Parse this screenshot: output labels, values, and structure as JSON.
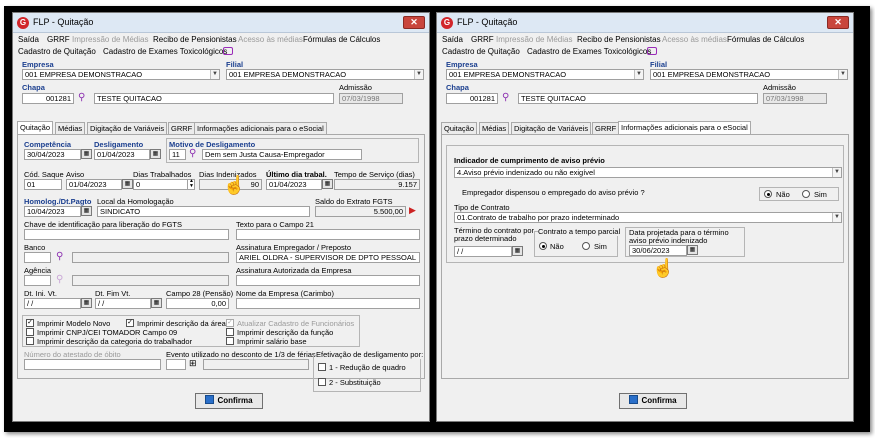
{
  "app": {
    "icon_letter": "G"
  },
  "win1": {
    "title": "FLP - Quitação",
    "close": "✕",
    "menu": [
      {
        "label": "Saída",
        "disabled": false
      },
      {
        "label": "GRRF",
        "disabled": false
      },
      {
        "label": "Impressão de Médias",
        "disabled": true
      },
      {
        "label": "Recibo de Pensionistas",
        "disabled": false
      },
      {
        "label": "Acesso às médias",
        "disabled": true
      },
      {
        "label": "Fórmulas de Cálculos",
        "disabled": false
      },
      {
        "label": "Cadastro de Quitação",
        "disabled": false
      },
      {
        "label": "Cadastro de Exames Toxicológicos",
        "disabled": false
      }
    ],
    "empresa_label": "Empresa",
    "empresa_value": "001 EMPRESA DEMONSTRACAO",
    "filial_label": "Filial",
    "filial_value": "001 EMPRESA DEMONSTRACAO",
    "chapa_label": "Chapa",
    "chapa_value": "001281",
    "nome_value": "TESTE QUITACAO",
    "admissao_label": "Admissão",
    "admissao_value": "07/03/1998",
    "tabs": [
      "Quitação",
      "Médias",
      "Digitação de Variáveis",
      "GRRF",
      "Informações adicionais para o eSocial"
    ],
    "competencia_label": "Competência",
    "competencia_value": "30/04/2023",
    "desligamento_label": "Desligamento",
    "desligamento_value": "01/04/2023",
    "motivo_label": "Motivo de Desligamento",
    "motivo_code": "11",
    "motivo_value": "Dem sem Justa Causa-Empregador",
    "cod_saque_label": "Cód. Saque",
    "cod_saque_value": "01",
    "aviso_label": "Aviso",
    "aviso_value": "01/04/2023",
    "dias_trab_label": "Dias Trabalhados",
    "dias_trab_value": "0",
    "dias_indeniz_label": "Dias Indenizados",
    "dias_indeniz_value": "90",
    "ultimo_dia_label": "Último dia trabal.",
    "ultimo_dia_value": "01/04/2023",
    "tempo_servico_label": "Tempo de Serviço (dias)",
    "tempo_servico_value": "9.157",
    "homolog_label": "Homolog./Dt.Pagto",
    "homolog_value": "10/04/2023",
    "local_homolog_label": "Local da Homologação",
    "local_homolog_value": "SINDICATO",
    "saldo_fgts_label": "Saldo do Extrato FGTS",
    "saldo_fgts_value": "5.500,00",
    "chave_label": "Chave de identificação para liberação do FGTS",
    "texto_campo21_label": "Texto para o Campo 21",
    "banco_label": "Banco",
    "assinatura_label": "Assinatura Empregador / Preposto",
    "assinatura_value": "ARIEL OLDRA - SUPERVISOR DE DPTO PESSOAL",
    "agencia_label": "Agência",
    "assinatura_aut_label": "Assinatura Autorizada da Empresa",
    "dt_ini_vt_label": "Dt. Ini. Vt.",
    "dt_ini_vt_value": " / /",
    "dt_fim_vt_label": "Dt. Fim Vt.",
    "dt_fim_vt_value": " / /",
    "campo28_label": "Campo 28 (Pensão)",
    "campo28_value": "0,00",
    "nome_empresa_label": "Nome da Empresa (Carimbo)",
    "checks": [
      {
        "label": "Imprimir Modelo Novo",
        "checked": true,
        "disabled": false
      },
      {
        "label": "Imprimir descrição da área",
        "checked": true,
        "disabled": false
      },
      {
        "label": "Atualizar Cadastro de Funcionários",
        "checked": true,
        "disabled": true
      },
      {
        "label": "Imprimir CNPJ/CEI TOMADOR Campo 09",
        "checked": false,
        "disabled": false
      },
      {
        "label": "Imprimir descrição da função",
        "checked": false,
        "disabled": false
      },
      {
        "label": "Imprimir descrição da categoria do trabalhador",
        "checked": false,
        "disabled": false
      },
      {
        "label": "Imprimir salário base",
        "checked": false,
        "disabled": false
      }
    ],
    "atestado_label": "Número do atestado de óbito",
    "evento_label": "Evento utilizado no desconto de 1/3 de férias",
    "efetivacao_label": "Efetivação de desligamento por:",
    "efetivacao_opts": [
      "1 - Redução de quadro",
      "2 - Substituição"
    ],
    "confirm": "Confirma"
  },
  "win2": {
    "title": "FLP - Quitação",
    "close": "✕",
    "indicador_label": "Indicador de cumprimento de aviso prévio",
    "indicador_value": "4.Aviso prévio indenizado ou não exigível",
    "dispensou_label": "Empregador dispensou o empregado do aviso prévio ?",
    "nao": "Não",
    "sim": "Sim",
    "tipo_contrato_label": "Tipo de Contrato",
    "tipo_contrato_value": "01.Contrato de trabalho por prazo indeterminado",
    "termino_label": "Término do contrato por prazo determinado",
    "termino_value": " / /",
    "tempo_parcial_label": "Contrato a tempo parcial",
    "data_proj_label": "Data projetada para o término aviso prévio indenizado",
    "data_proj_value": "30/06/2023",
    "confirm": "Confirma"
  }
}
